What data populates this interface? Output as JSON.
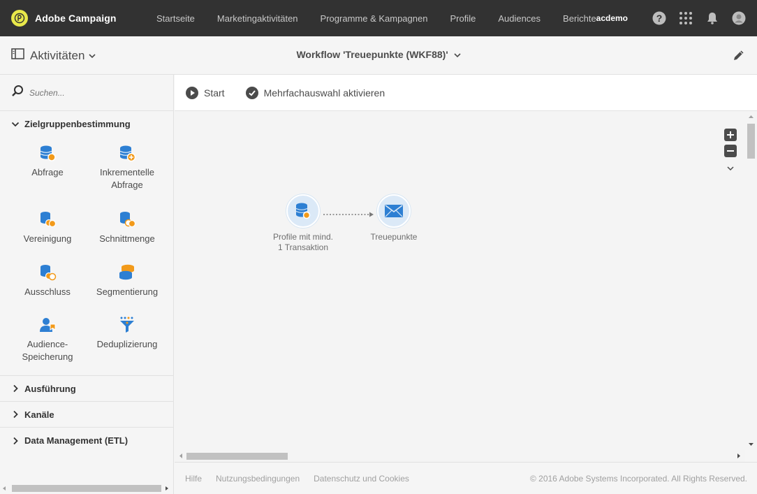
{
  "brand": {
    "name": "Adobe Campaign"
  },
  "topnav": {
    "items": [
      "Startseite",
      "Marketingaktivitäten",
      "Programme & Kampagnen",
      "Profile",
      "Audiences",
      "Berichte"
    ]
  },
  "user": {
    "name": "acdemo"
  },
  "header": {
    "activities_label": "Aktivitäten",
    "workflow_title": "Workflow 'Treuepunkte (WKF88)'"
  },
  "sidebar": {
    "search_placeholder": "Suchen...",
    "sections": {
      "targeting": "Zielgruppenbestimmung",
      "execution": "Ausführung",
      "channels": "Kanäle",
      "data_management": "Data Management (ETL)"
    },
    "activities": {
      "query": "Abfrage",
      "incremental_query": "Inkrementelle Abfrage",
      "union": "Vereinigung",
      "intersection": "Schnittmenge",
      "exclusion": "Ausschluss",
      "segmentation": "Segmentierung",
      "save_audience": "Audience-Speicherung",
      "deduplication": "Deduplizierung"
    }
  },
  "toolbar": {
    "start_label": "Start",
    "multiselect_label": "Mehrfachauswahl aktivieren"
  },
  "canvas": {
    "nodes": {
      "query_label": "Profile mit mind. 1 Transaktion",
      "email_label": "Treuepunkte"
    }
  },
  "footer": {
    "links": [
      "Hilfe",
      "Nutzungsbedingungen",
      "Datenschutz und Cookies"
    ],
    "copyright": "© 2016 Adobe Systems Incorporated. All Rights Reserved."
  },
  "colors": {
    "topbar": "#323232",
    "accent_blue": "#2d7fd3",
    "accent_orange": "#f29a1a",
    "node_bg": "#dbe9f7"
  },
  "icons": {
    "brand": "adobe-campaign-logo-icon",
    "help": "help-icon",
    "apps": "apps-grid-icon",
    "notifications": "bell-icon",
    "avatar": "user-avatar-icon",
    "panel": "sidebar-panel-icon",
    "edit": "pencil-icon",
    "search": "search-icon",
    "start": "play-icon",
    "multiselect": "check-circle-icon",
    "zoom_in": "plus-icon",
    "zoom_out": "minus-icon",
    "email": "envelope-icon"
  }
}
